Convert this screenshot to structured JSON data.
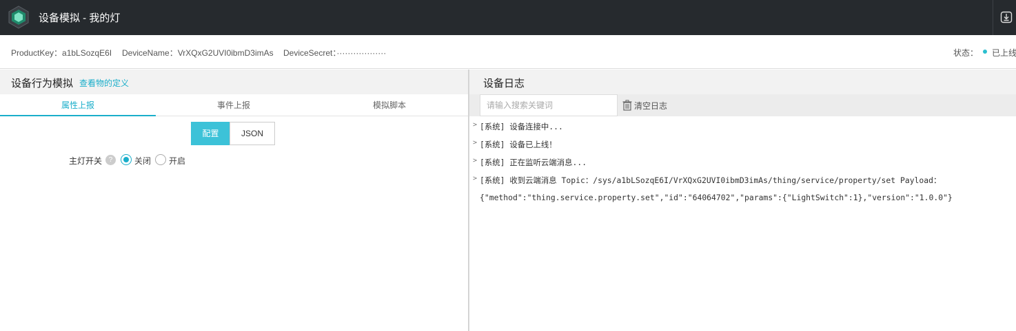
{
  "app": {
    "title": "设备模拟 - 我的灯"
  },
  "info": {
    "product_key": "ProductKey：a1bLSozqE6I",
    "device_name": "DeviceName：VrXQxG2UVI0ibmD3imAs",
    "device_secret": "DeviceSecret：··················",
    "status_label": "状态：",
    "status_value": "已上线",
    "status_color": "#2bbfcf"
  },
  "left": {
    "title": "设备行为模拟",
    "link": "查看物的定义",
    "tabs": [
      "属性上报",
      "事件上报",
      "模拟脚本"
    ],
    "mode_buttons": [
      "配置",
      "JSON"
    ],
    "property": {
      "label": "主灯开关",
      "help": "?",
      "options": [
        "关闭",
        "开启"
      ],
      "selected": "关闭"
    }
  },
  "right": {
    "title": "设备日志",
    "search_placeholder": "请输入搜索关键词",
    "clear_label": "清空日志",
    "logs": [
      "[系统] 设备连接中...",
      "[系统] 设备已上线！",
      "[系统] 正在监听云端消息...",
      "[系统] 收到云端消息 Topic：/sys/a1bLSozqE6I/VrXQxG2UVI0ibmD3imAs/thing/service/property/set Payload："
    ],
    "payload": "{\"method\":\"thing.service.property.set\",\"id\":\"64064702\",\"params\":{\"LightSwitch\":1},\"version\":\"1.0.0\"}"
  },
  "colors": {
    "accent": "#1aaeca",
    "topbar": "#262a2e"
  },
  "icons": [
    "logo-icon",
    "download-icon",
    "help-icon",
    "trash-icon"
  ]
}
